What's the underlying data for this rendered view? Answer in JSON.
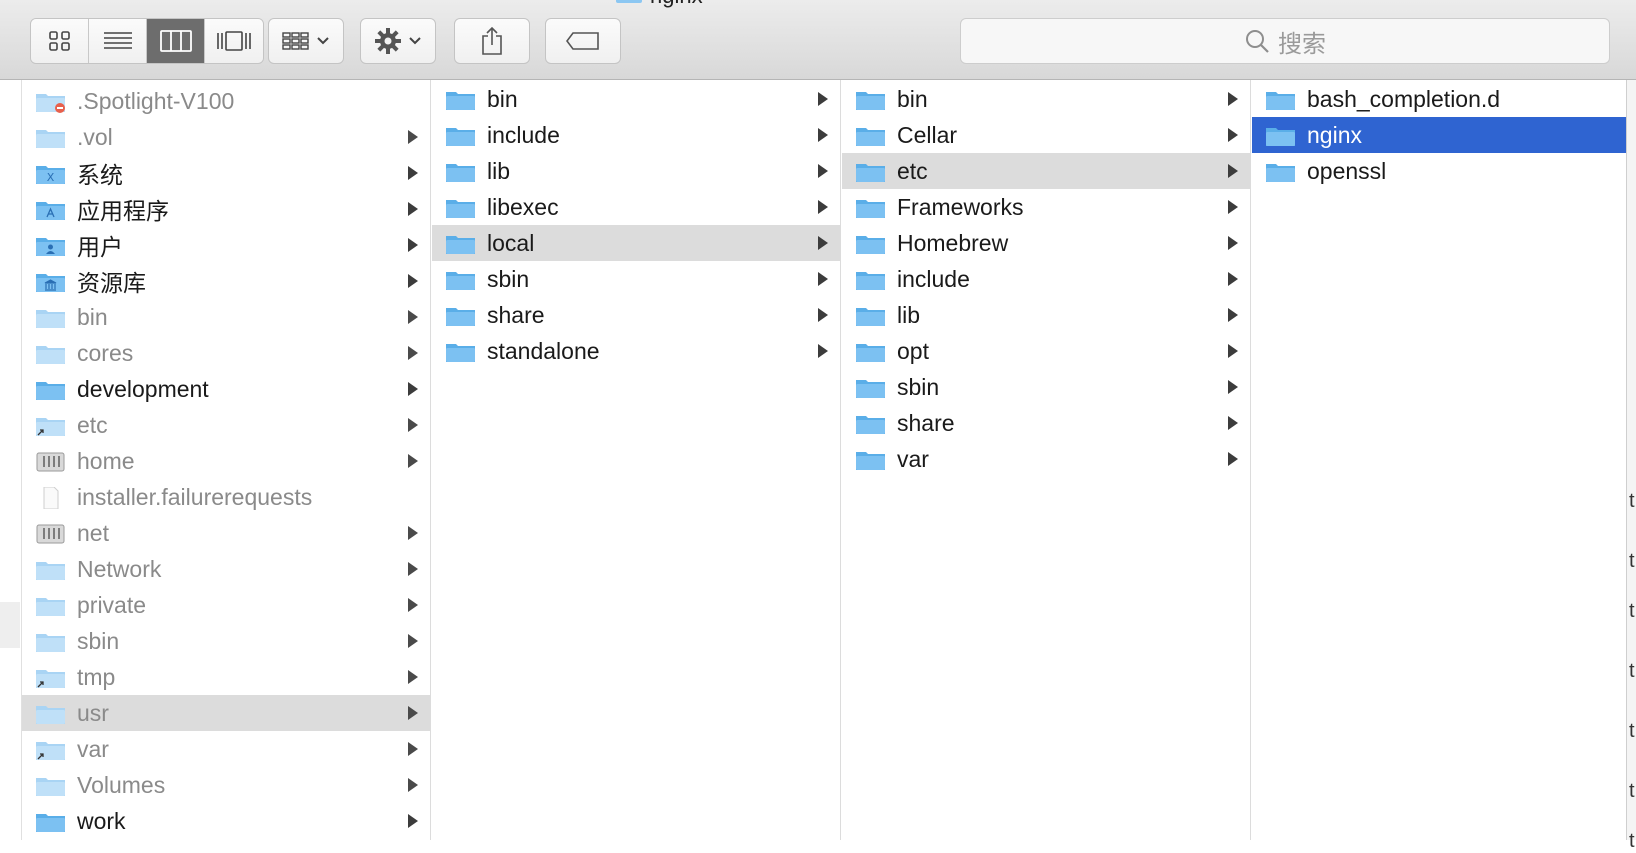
{
  "window": {
    "title": "nginx"
  },
  "toolbar": {
    "view_modes": [
      "icon-view-icon",
      "list-view-icon",
      "column-view-icon",
      "cover-flow-icon"
    ],
    "active_view": 2,
    "search_placeholder": "搜索"
  },
  "columns": [
    {
      "items": [
        {
          "label": ".Spotlight-V100",
          "icon": "folder-restricted",
          "arrow": false,
          "dim": true
        },
        {
          "label": ".vol",
          "icon": "folder",
          "arrow": true,
          "dim": true
        },
        {
          "label": "系统",
          "icon": "folder-system",
          "arrow": true,
          "dim": false
        },
        {
          "label": "应用程序",
          "icon": "folder-applications",
          "arrow": true,
          "dim": false
        },
        {
          "label": "用户",
          "icon": "folder-users",
          "arrow": true,
          "dim": false
        },
        {
          "label": "资源库",
          "icon": "folder-library",
          "arrow": true,
          "dim": false
        },
        {
          "label": "bin",
          "icon": "folder",
          "arrow": true,
          "dim": true
        },
        {
          "label": "cores",
          "icon": "folder",
          "arrow": true,
          "dim": true
        },
        {
          "label": "development",
          "icon": "folder",
          "arrow": true,
          "dim": false
        },
        {
          "label": "etc",
          "icon": "folder-alias",
          "arrow": true,
          "dim": true
        },
        {
          "label": "home",
          "icon": "network-drive",
          "arrow": true,
          "dim": true
        },
        {
          "label": "installer.failurerequests",
          "icon": "document",
          "arrow": false,
          "dim": true
        },
        {
          "label": "net",
          "icon": "network-drive",
          "arrow": true,
          "dim": true
        },
        {
          "label": "Network",
          "icon": "folder",
          "arrow": true,
          "dim": true
        },
        {
          "label": "private",
          "icon": "folder",
          "arrow": true,
          "dim": true
        },
        {
          "label": "sbin",
          "icon": "folder",
          "arrow": true,
          "dim": true
        },
        {
          "label": "tmp",
          "icon": "folder-alias",
          "arrow": true,
          "dim": true
        },
        {
          "label": "usr",
          "icon": "folder",
          "arrow": true,
          "dim": true,
          "selected": "gray"
        },
        {
          "label": "var",
          "icon": "folder-alias",
          "arrow": true,
          "dim": true
        },
        {
          "label": "Volumes",
          "icon": "folder",
          "arrow": true,
          "dim": true
        },
        {
          "label": "work",
          "icon": "folder",
          "arrow": true,
          "dim": false
        }
      ]
    },
    {
      "items": [
        {
          "label": "bin",
          "icon": "folder",
          "arrow": true
        },
        {
          "label": "include",
          "icon": "folder",
          "arrow": true
        },
        {
          "label": "lib",
          "icon": "folder",
          "arrow": true
        },
        {
          "label": "libexec",
          "icon": "folder",
          "arrow": true
        },
        {
          "label": "local",
          "icon": "folder",
          "arrow": true,
          "selected": "gray"
        },
        {
          "label": "sbin",
          "icon": "folder",
          "arrow": true
        },
        {
          "label": "share",
          "icon": "folder",
          "arrow": true
        },
        {
          "label": "standalone",
          "icon": "folder",
          "arrow": true
        }
      ]
    },
    {
      "items": [
        {
          "label": "bin",
          "icon": "folder",
          "arrow": true
        },
        {
          "label": "Cellar",
          "icon": "folder",
          "arrow": true
        },
        {
          "label": "etc",
          "icon": "folder",
          "arrow": true,
          "selected": "gray"
        },
        {
          "label": "Frameworks",
          "icon": "folder",
          "arrow": true
        },
        {
          "label": "Homebrew",
          "icon": "folder",
          "arrow": true
        },
        {
          "label": "include",
          "icon": "folder",
          "arrow": true
        },
        {
          "label": "lib",
          "icon": "folder",
          "arrow": true
        },
        {
          "label": "opt",
          "icon": "folder",
          "arrow": true
        },
        {
          "label": "sbin",
          "icon": "folder",
          "arrow": true
        },
        {
          "label": "share",
          "icon": "folder",
          "arrow": true
        },
        {
          "label": "var",
          "icon": "folder",
          "arrow": true
        }
      ]
    },
    {
      "items": [
        {
          "label": "bash_completion.d",
          "icon": "folder",
          "arrow": false
        },
        {
          "label": "nginx",
          "icon": "folder",
          "arrow": false,
          "selected": "blue"
        },
        {
          "label": "openssl",
          "icon": "folder",
          "arrow": false
        }
      ]
    }
  ],
  "colors": {
    "folder": "#7cc1f2",
    "folder_dark": "#5aaee8",
    "selection_blue": "#2f64d1",
    "selection_gray": "#dcdcdc"
  }
}
